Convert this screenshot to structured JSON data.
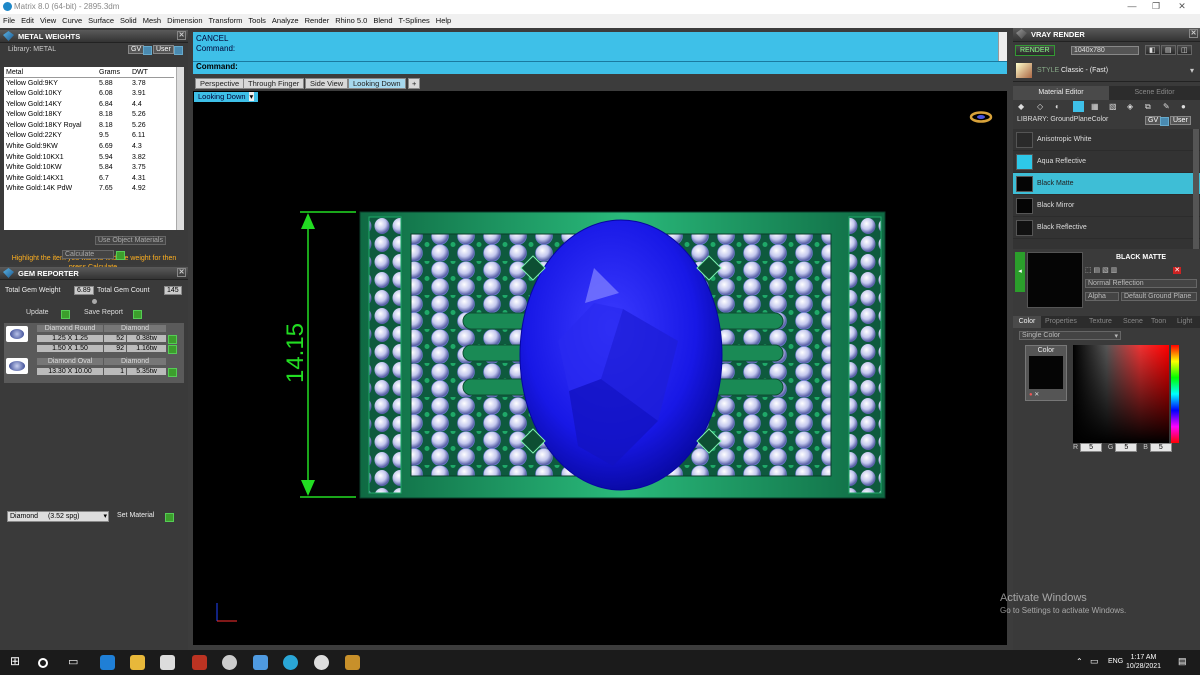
{
  "window": {
    "title": "Matrix 8.0 (64-bit) - 2895.3dm"
  },
  "menu": [
    "File",
    "Edit",
    "View",
    "Curve",
    "Surface",
    "Solid",
    "Mesh",
    "Dimension",
    "Transform",
    "Tools",
    "Analyze",
    "Render",
    "Rhino 5.0",
    "Blend",
    "T-Splines",
    "Help"
  ],
  "metal_weights": {
    "title": "METAL WEIGHTS",
    "library_label": "Library: METAL",
    "gv": "GV",
    "user": "User",
    "headers": [
      "Metal",
      "Grams",
      "DWT"
    ],
    "rows": [
      [
        "Yellow Gold:9KY",
        "5.88",
        "3.78"
      ],
      [
        "Yellow Gold:10KY",
        "6.08",
        "3.91"
      ],
      [
        "Yellow Gold:14KY",
        "6.84",
        "4.4"
      ],
      [
        "Yellow Gold:18KY",
        "8.18",
        "5.26"
      ],
      [
        "Yellow Gold:18KY Royal",
        "8.18",
        "5.26"
      ],
      [
        "Yellow Gold:22KY",
        "9.5",
        "6.11"
      ],
      [
        "White Gold:9KW",
        "6.69",
        "4.3"
      ],
      [
        "White Gold:10KX1",
        "5.94",
        "3.82"
      ],
      [
        "White Gold:10KW",
        "5.84",
        "3.75"
      ],
      [
        "White Gold:14KX1",
        "6.7",
        "4.31"
      ],
      [
        "White Gold:14K PdW",
        "7.65",
        "4.92"
      ]
    ],
    "use_object_materials": "Use Object Materials",
    "hint": "Highlight the item you want to find the weight for then press Calculate.",
    "calculate": "Calculate"
  },
  "gem_reporter": {
    "title": "GEM REPORTER",
    "total_weight_label": "Total Gem Weight",
    "total_weight": "6.89",
    "total_count_label": "Total Gem Count",
    "total_count": "145",
    "update": "Update",
    "save_report": "Save Report",
    "groups": [
      {
        "shape": "Diamond Round",
        "material": "Diamond",
        "rows": [
          [
            "1.25 X 1.25",
            "52",
            "0.38tw"
          ],
          [
            "1.50 X 1.50",
            "92",
            "1.16tw"
          ]
        ]
      },
      {
        "shape": "Diamond Oval",
        "material": "Diamond",
        "rows": [
          [
            "13.30 X 10.00",
            "1",
            "5.35tw"
          ]
        ]
      }
    ],
    "material_select": "Diamond",
    "material_sg": "(3.52 spg)",
    "set_material": "Set Material"
  },
  "command": {
    "line1": "CANCEL",
    "line2": "Command:",
    "prompt": "Command:"
  },
  "viewport_tabs": [
    "Perspective",
    "Through Finger",
    "Side View",
    "Looking Down"
  ],
  "active_tab": "Looking Down",
  "viewport_label": "Looking Down",
  "dimension_value": "14.15",
  "colors": {
    "accent": "#3ec0e8",
    "gem": "#1a1aee",
    "metal": "#1f9a63",
    "dimension": "#22dd22"
  },
  "vray": {
    "title": "VRAY RENDER",
    "render": "RENDER",
    "resolution": "1040x780",
    "style_label": "STYLE",
    "style_value": "Classic - (Fast)",
    "tabs": [
      "Material Editor",
      "Scene Editor"
    ],
    "library": "LIBRARY: GroundPlaneColor",
    "materials": [
      {
        "name": "Anisotropic White",
        "color": "#2a2a2a"
      },
      {
        "name": "Aqua Reflective",
        "color": "#2ec8e8"
      },
      {
        "name": "Black Matte",
        "color": "#050505"
      },
      {
        "name": "Black Mirror",
        "color": "#050505"
      },
      {
        "name": "Black Reflective",
        "color": "#111111"
      }
    ],
    "selected_material": "BLACK MATTE",
    "reflection": "Normal Reflection",
    "alpha": "Alpha",
    "ground_plane": "Default Ground Plane",
    "subtabs": [
      "Color",
      "Properties",
      "Texture",
      "Scene",
      "Toon",
      "Light"
    ],
    "color_mode": "Single Color",
    "color_label": "Color",
    "r": "5",
    "g": "5",
    "b": "5"
  },
  "watermark": {
    "line1": "Activate Windows",
    "line2": "Go to Settings to activate Windows."
  },
  "taskbar": {
    "lang": "ENG",
    "time": "1:17 AM",
    "date": "10/28/2021"
  }
}
